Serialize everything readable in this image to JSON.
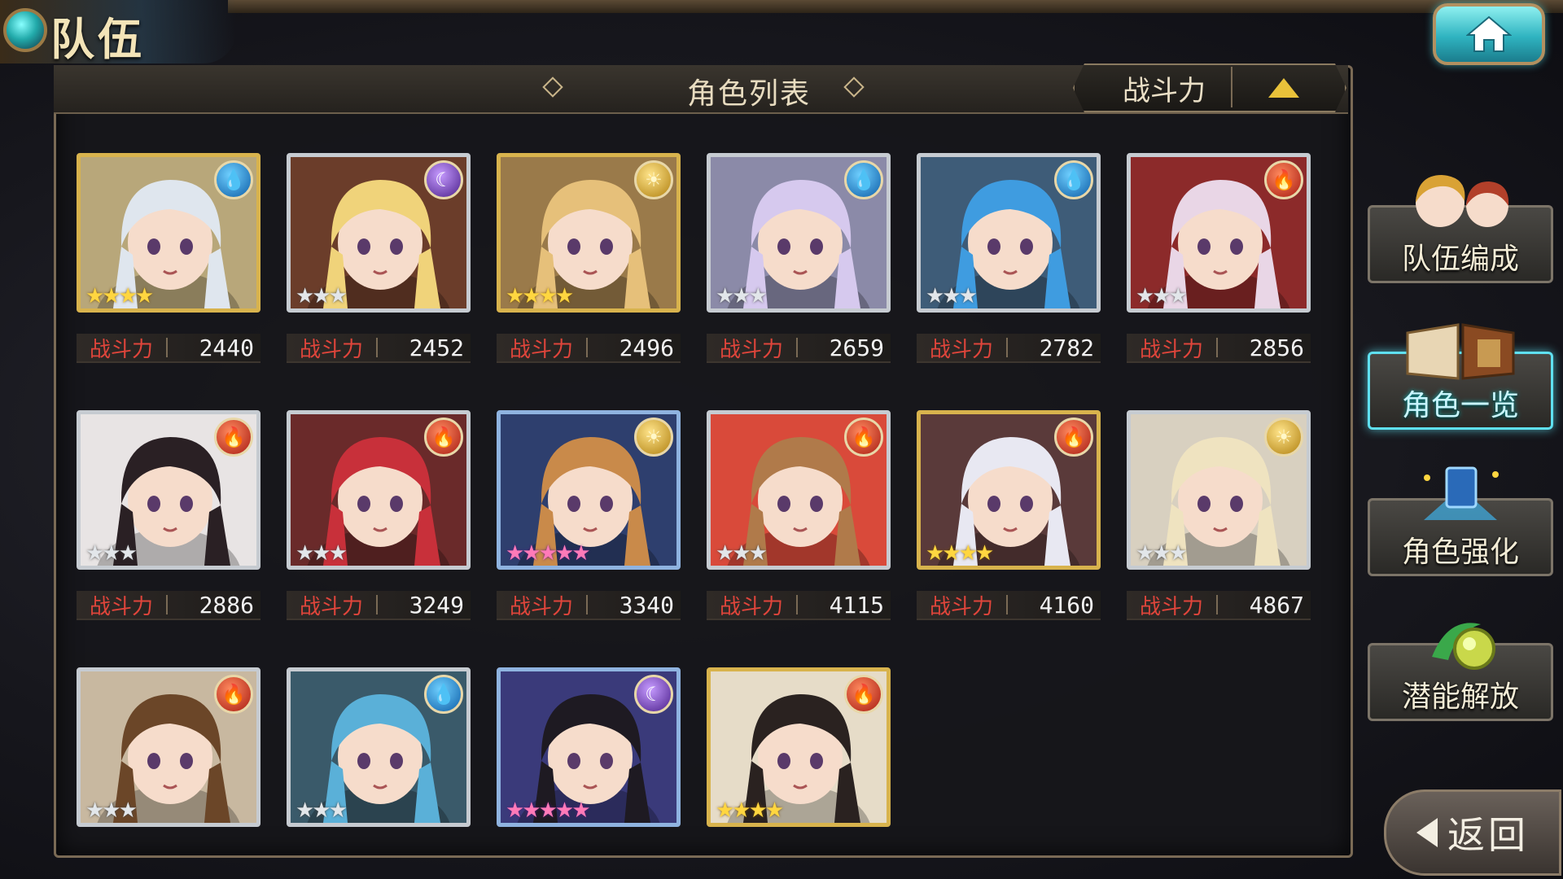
{
  "header": {
    "screen_title": "队伍"
  },
  "panel": {
    "title": "角色列表",
    "sort_label": "战斗力",
    "sort_direction": "ascending"
  },
  "power_label": "战斗力",
  "characters": [
    {
      "power": "2440",
      "frame": "gold",
      "element": "water",
      "stars": 4,
      "hair": "#dfe6ee",
      "bg": "#b8a77a"
    },
    {
      "power": "2452",
      "frame": "silver",
      "element": "dark",
      "stars": 3,
      "hair": "#f0d37a",
      "bg": "#6b3d2a"
    },
    {
      "power": "2496",
      "frame": "gold",
      "element": "light",
      "stars": 4,
      "hair": "#e6c07a",
      "bg": "#9a7a4a"
    },
    {
      "power": "2659",
      "frame": "silver",
      "element": "water",
      "stars": 3,
      "hair": "#d6c9ee",
      "bg": "#8b8aa8"
    },
    {
      "power": "2782",
      "frame": "silver",
      "element": "water",
      "stars": 3,
      "hair": "#3f9ce0",
      "bg": "#3e5c78"
    },
    {
      "power": "2856",
      "frame": "silver",
      "element": "fire",
      "stars": 3,
      "hair": "#e9d6e6",
      "bg": "#8c2a2a"
    },
    {
      "power": "2886",
      "frame": "silver",
      "element": "fire",
      "stars": 3,
      "hair": "#2a2024",
      "bg": "#e8e4e4"
    },
    {
      "power": "3249",
      "frame": "silver",
      "element": "fire",
      "stars": 3,
      "hair": "#c8303a",
      "bg": "#6a2a2a"
    },
    {
      "power": "3340",
      "frame": "rainbow",
      "element": "light",
      "stars": 5,
      "hair": "#c98a4a",
      "bg": "#2e3f6e"
    },
    {
      "power": "4115",
      "frame": "silver",
      "element": "fire",
      "stars": 3,
      "hair": "#b07a4a",
      "bg": "#d94a3a"
    },
    {
      "power": "4160",
      "frame": "gold",
      "element": "fire",
      "stars": 4,
      "hair": "#e8e8f2",
      "bg": "#5a3a3a"
    },
    {
      "power": "4867",
      "frame": "silver",
      "element": "light",
      "stars": 3,
      "hair": "#efe3c0",
      "bg": "#d8d0c0"
    },
    {
      "power": "",
      "frame": "silver",
      "element": "fire",
      "stars": 3,
      "hair": "#6b4628",
      "bg": "#c8b8a0"
    },
    {
      "power": "",
      "frame": "silver",
      "element": "water",
      "stars": 3,
      "hair": "#5ab0d8",
      "bg": "#3a5a6a"
    },
    {
      "power": "",
      "frame": "rainbow",
      "element": "dark",
      "stars": 5,
      "hair": "#1e1a22",
      "bg": "#3a3a7a"
    },
    {
      "power": "",
      "frame": "gold",
      "element": "fire",
      "stars": 4,
      "hair": "#2a2220",
      "bg": "#e6dcc8"
    }
  ],
  "side_menu": [
    {
      "label": "队伍编成",
      "icon": "team-chibi-icon",
      "active": false
    },
    {
      "label": "角色一览",
      "icon": "book-icon",
      "active": true
    },
    {
      "label": "角色强化",
      "icon": "card-upgrade-icon",
      "active": false
    },
    {
      "label": "潜能解放",
      "icon": "potential-orb-icon",
      "active": false
    }
  ],
  "back_label": "返回",
  "colors": {
    "water": "#1e8ee0",
    "fire": "#d0321f",
    "light": "#d8a21a",
    "dark": "#7a3ed0",
    "accent": "#5fe0f0"
  }
}
